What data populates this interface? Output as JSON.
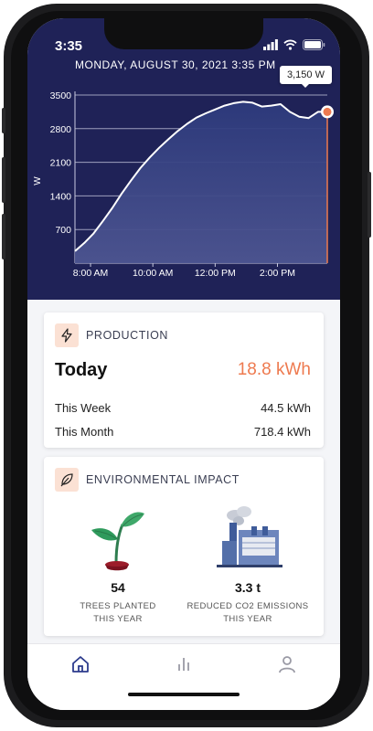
{
  "status": {
    "time": "3:35"
  },
  "chart": {
    "title": "MONDAY, AUGUST 30, 2021 3:35 PM",
    "tooltip": "3,150 W",
    "ylabel": "W"
  },
  "chart_data": {
    "type": "area",
    "title": "MONDAY, AUGUST 30, 2021 3:35 PM",
    "xlabel": "",
    "ylabel": "W",
    "ylim": [
      0,
      3500
    ],
    "yticks": [
      700,
      1400,
      2100,
      2800,
      3500
    ],
    "xticks": [
      "8:00 AM",
      "10:00 AM",
      "12:00 PM",
      "2:00 PM"
    ],
    "xtick_hours": [
      8,
      10,
      12,
      14
    ],
    "xlim_hours": [
      7.5,
      15.6
    ],
    "grid": true,
    "series": [
      {
        "x_hours": [
          7.5,
          7.8,
          8.1,
          8.4,
          8.7,
          9.0,
          9.3,
          9.6,
          9.9,
          10.2,
          10.5,
          10.8,
          11.1,
          11.4,
          11.7,
          12.0,
          12.3,
          12.6,
          12.9,
          13.2,
          13.5,
          13.8,
          14.1,
          14.4,
          14.7,
          15.0,
          15.3,
          15.6
        ],
        "y": [
          250,
          420,
          620,
          880,
          1150,
          1450,
          1720,
          1980,
          2200,
          2400,
          2580,
          2750,
          2900,
          3030,
          3120,
          3200,
          3280,
          3330,
          3360,
          3340,
          3260,
          3280,
          3310,
          3150,
          3050,
          3020,
          3150,
          3150
        ]
      }
    ]
  },
  "production": {
    "title": "PRODUCTION",
    "today_label": "Today",
    "today_value": "18.8 kWh",
    "rows": [
      {
        "label": "This Week",
        "value": "44.5 kWh"
      },
      {
        "label": "This Month",
        "value": "718.4 kWh"
      }
    ]
  },
  "impact": {
    "title": "ENVIRONMENTAL IMPACT",
    "trees": {
      "value": "54",
      "caption": "TREES PLANTED\nTHIS YEAR"
    },
    "co2": {
      "value": "3.3 t",
      "caption": "REDUCED CO2 EMISSIONS\nTHIS YEAR"
    }
  },
  "colors": {
    "header_bg": "#1f2257",
    "accent": "#ee7a4f",
    "tab_active": "#2b3a8c",
    "tab_inactive": "#9a9aa5"
  },
  "tabs": [
    {
      "icon": "home-icon",
      "active": true
    },
    {
      "icon": "bar-chart-icon",
      "active": false
    },
    {
      "icon": "profile-icon",
      "active": false
    }
  ]
}
